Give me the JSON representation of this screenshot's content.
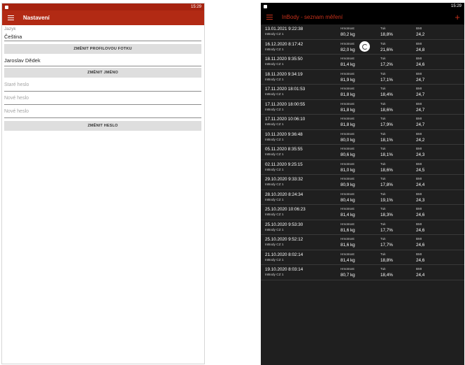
{
  "settings": {
    "status_time": "15:29",
    "title": "Nastavení",
    "language_caption": "Jazyk",
    "language_value": "Čeština",
    "change_photo_label": "ZMĚNIT PROFILOVOU FOTKU",
    "name_value": "Jaroslav Dědek",
    "change_name_label": "ZMĚNIT JMÉNO",
    "old_password_placeholder": "Staré heslo",
    "new_password_placeholder": "Nové heslo",
    "new_password2_placeholder": "Nové heslo",
    "change_password_label": "ZMĚNIT HESLO"
  },
  "inbody": {
    "status_time": "15:29",
    "title": "InBody - seznam měření",
    "add_icon": "+",
    "labels": {
      "weight": "Hmotnost",
      "fat": "Tuk",
      "bmi": "BMI"
    },
    "rows": [
      {
        "date": "13.01.2021 9:22:38",
        "device": "InBody CZ 1",
        "weight": "80,2 kg",
        "fat": "18,8%",
        "bmi": "24,2"
      },
      {
        "date": "16.12.2020 8:17:42",
        "device": "InBody CZ 1",
        "weight": "82,0 kg",
        "fat": "21,6%",
        "bmi": "24,8"
      },
      {
        "date": "18.11.2020 9:35:50",
        "device": "InBody CZ 1",
        "weight": "81,4 kg",
        "fat": "17,2%",
        "bmi": "24,6"
      },
      {
        "date": "18.11.2020 9:34:19",
        "device": "InBody CZ 1",
        "weight": "81,9 kg",
        "fat": "17,1%",
        "bmi": "24,7"
      },
      {
        "date": "17.11.2020 18:01:53",
        "device": "InBody CZ 1",
        "weight": "81,8 kg",
        "fat": "18,4%",
        "bmi": "24,7"
      },
      {
        "date": "17.11.2020 18:00:55",
        "device": "InBody CZ 1",
        "weight": "81,8 kg",
        "fat": "18,6%",
        "bmi": "24,7"
      },
      {
        "date": "17.11.2020 10:06:10",
        "device": "InBody CZ 1",
        "weight": "81,8 kg",
        "fat": "17,9%",
        "bmi": "24,7"
      },
      {
        "date": "10.11.2020 9:36:48",
        "device": "InBody CZ 1",
        "weight": "80,0 kg",
        "fat": "18,1%",
        "bmi": "24,2"
      },
      {
        "date": "05.11.2020 8:35:55",
        "device": "InBody CZ 1",
        "weight": "80,6 kg",
        "fat": "18,1%",
        "bmi": "24,3"
      },
      {
        "date": "02.11.2020 9:25:15",
        "device": "InBody CZ 1",
        "weight": "81,0 kg",
        "fat": "18,6%",
        "bmi": "24,5"
      },
      {
        "date": "29.10.2020 9:33:32",
        "device": "InBody CZ 1",
        "weight": "80,9 kg",
        "fat": "17,8%",
        "bmi": "24,4"
      },
      {
        "date": "28.10.2020 8:24:34",
        "device": "InBody CZ 1",
        "weight": "80,4 kg",
        "fat": "19,1%",
        "bmi": "24,3"
      },
      {
        "date": "25.10.2020 10:06:23",
        "device": "InBody CZ 1",
        "weight": "81,4 kg",
        "fat": "18,3%",
        "bmi": "24,6"
      },
      {
        "date": "25.10.2020 9:53:30",
        "device": "InBody CZ 1",
        "weight": "81,6 kg",
        "fat": "17,7%",
        "bmi": "24,6"
      },
      {
        "date": "25.10.2020 9:52:12",
        "device": "InBody CZ 1",
        "weight": "81,6 kg",
        "fat": "17,7%",
        "bmi": "24,6"
      },
      {
        "date": "21.10.2020 8:02:14",
        "device": "InBody CZ 1",
        "weight": "81,4 kg",
        "fat": "18,8%",
        "bmi": "24,6"
      },
      {
        "date": "19.10.2020 8:03:14",
        "device": "InBody CZ 1",
        "weight": "80,7 kg",
        "fat": "18,4%",
        "bmi": "24,4"
      }
    ]
  },
  "colors": {
    "brand_red": "#b22a14",
    "accent_red": "#c9321c",
    "dark_bg": "#1f1f1f"
  }
}
